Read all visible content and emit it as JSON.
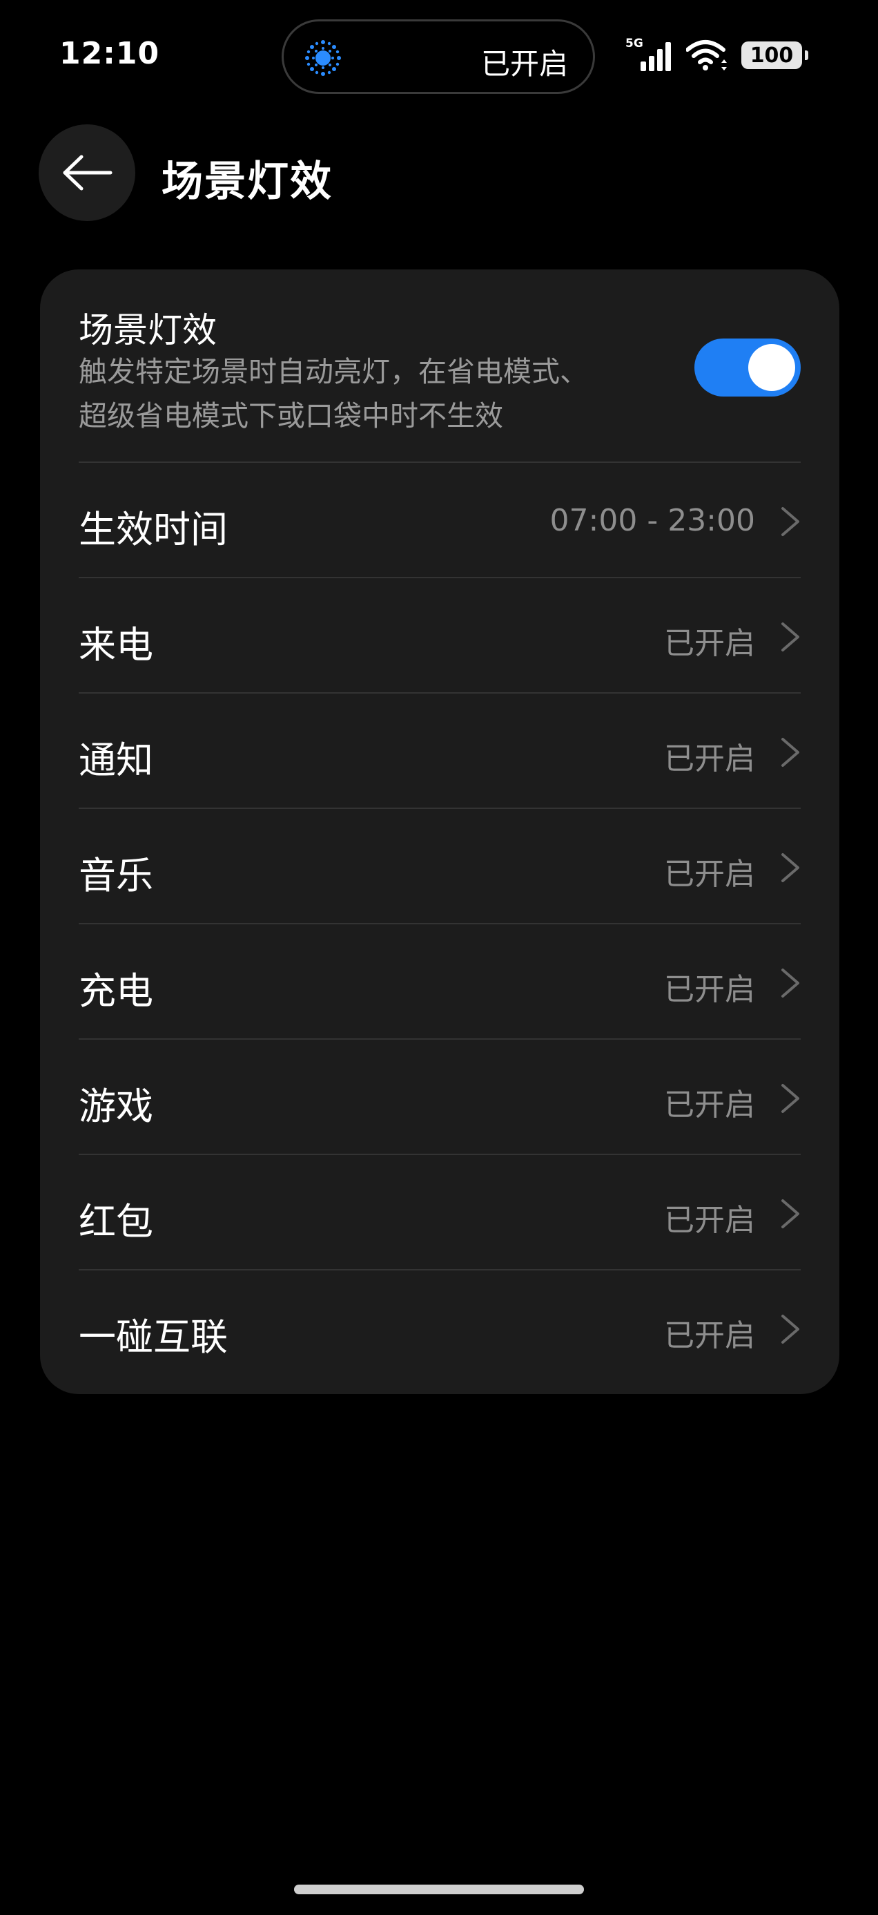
{
  "status_bar": {
    "time": "12:10",
    "island_text": "已开启",
    "island_icon": "light-effect-icon",
    "network": "5G",
    "battery": "100",
    "accent": "#1f7ff4"
  },
  "header": {
    "title": "场景灯效",
    "back_icon": "arrow-left-icon"
  },
  "master": {
    "title": "场景灯效",
    "description_line1": "触发特定场景时自动亮灯，在省电模式、",
    "description_line2": "超级省电模式下或口袋中时不生效",
    "enabled": true
  },
  "rows": [
    {
      "label": "生效时间",
      "value": "07:00 - 23:00"
    },
    {
      "label": "来电",
      "value": "已开启"
    },
    {
      "label": "通知",
      "value": "已开启"
    },
    {
      "label": "音乐",
      "value": "已开启"
    },
    {
      "label": "充电",
      "value": "已开启"
    },
    {
      "label": "游戏",
      "value": "已开启"
    },
    {
      "label": "红包",
      "value": "已开启"
    },
    {
      "label": "一碰互联",
      "value": "已开启"
    }
  ]
}
